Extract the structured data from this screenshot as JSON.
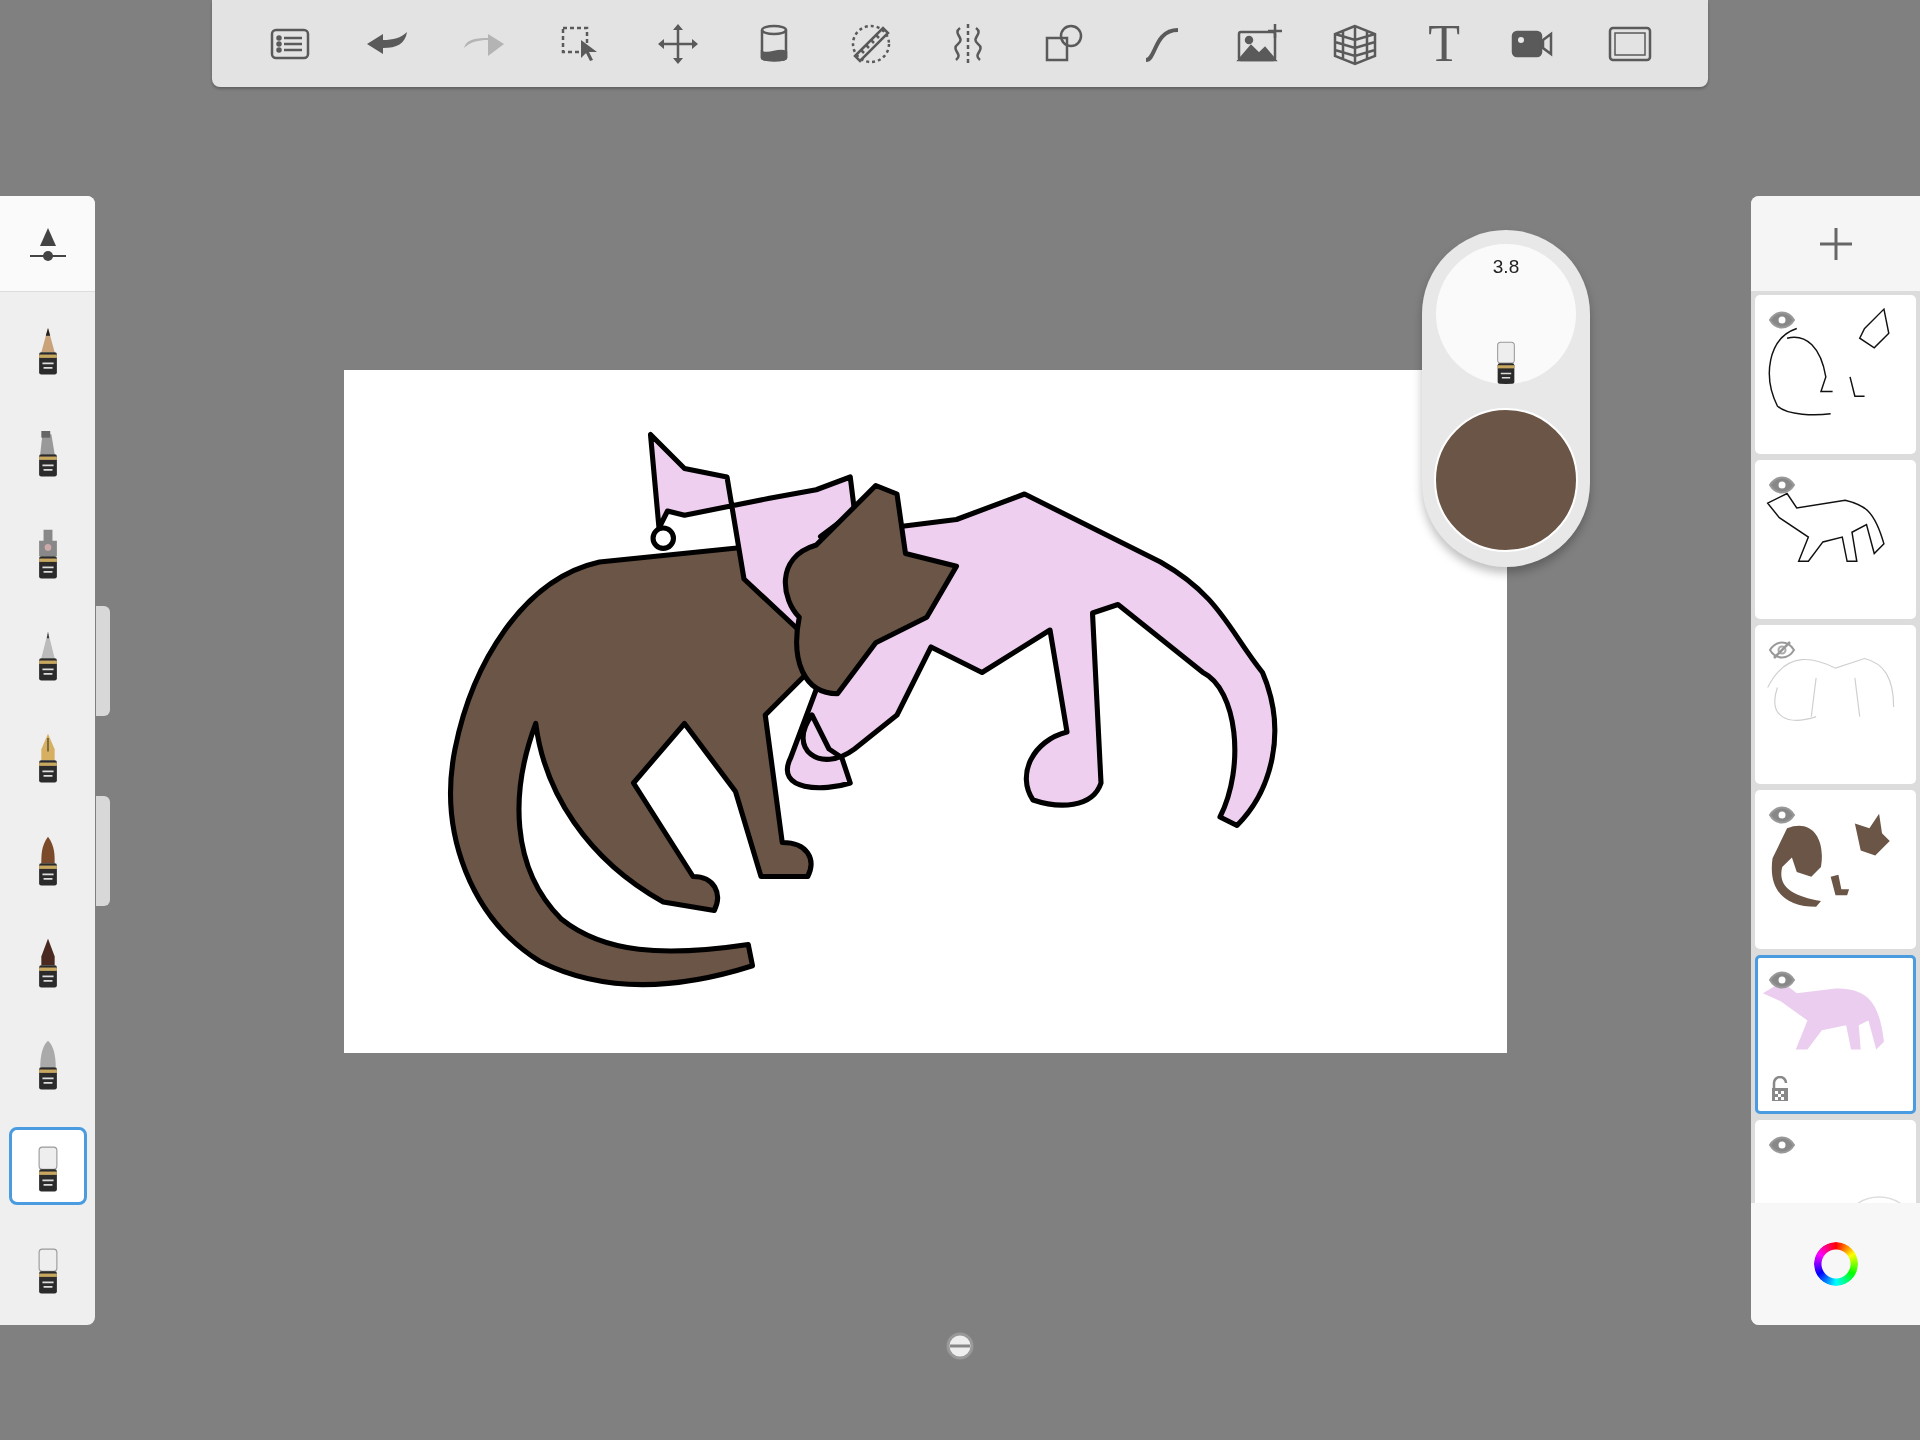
{
  "toolbar": [
    {
      "kind": "list",
      "disabled": false
    },
    {
      "kind": "undo",
      "disabled": false
    },
    {
      "kind": "redo",
      "disabled": true
    },
    {
      "kind": "select",
      "disabled": false
    },
    {
      "kind": "move",
      "disabled": false
    },
    {
      "kind": "fill",
      "disabled": false
    },
    {
      "kind": "ruler",
      "disabled": false
    },
    {
      "kind": "symmetry",
      "disabled": false
    },
    {
      "kind": "shapes",
      "disabled": false
    },
    {
      "kind": "curve",
      "disabled": false
    },
    {
      "kind": "image",
      "disabled": false
    },
    {
      "kind": "perspective",
      "disabled": false
    },
    {
      "kind": "text",
      "label": "T",
      "disabled": false
    },
    {
      "kind": "video",
      "disabled": false
    },
    {
      "kind": "fullscreen",
      "disabled": false
    }
  ],
  "brushes": [
    {
      "kind": "pencil",
      "selected": false
    },
    {
      "kind": "marker",
      "selected": false
    },
    {
      "kind": "airbrush",
      "selected": false
    },
    {
      "kind": "ballpoint",
      "selected": false
    },
    {
      "kind": "nib",
      "selected": false
    },
    {
      "kind": "paintbrush",
      "selected": false
    },
    {
      "kind": "inkpen",
      "selected": false
    },
    {
      "kind": "smudge",
      "selected": false
    },
    {
      "kind": "eraser",
      "selected": true
    },
    {
      "kind": "eraser",
      "selected": false
    }
  ],
  "brush_puck": {
    "size": "3.8",
    "color": "#6b5546"
  },
  "layers": [
    {
      "kind": "outline-pair",
      "visible": true,
      "selected": false,
      "alpha_locked": false
    },
    {
      "kind": "outline-single",
      "visible": true,
      "selected": false,
      "alpha_locked": false
    },
    {
      "kind": "sketch",
      "visible": false,
      "selected": false,
      "alpha_locked": false
    },
    {
      "kind": "brown-fill",
      "visible": true,
      "selected": false,
      "alpha_locked": false
    },
    {
      "kind": "pink-fill",
      "visible": true,
      "selected": true,
      "alpha_locked": true
    },
    {
      "kind": "background",
      "visible": true,
      "selected": false,
      "alpha_locked": false
    }
  ]
}
